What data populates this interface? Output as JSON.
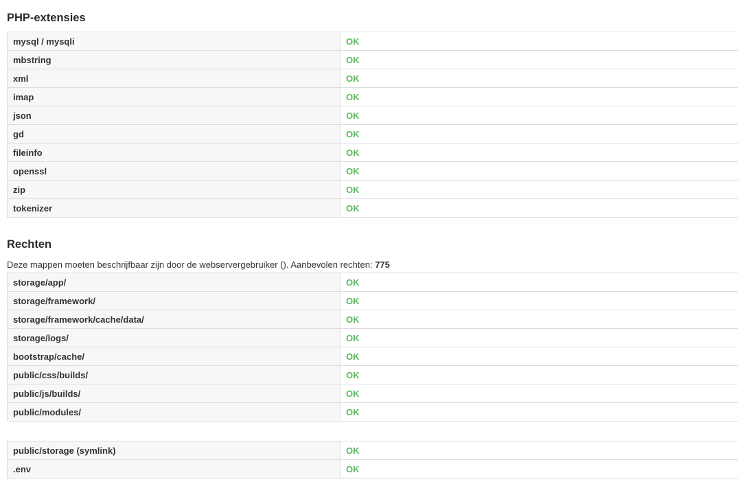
{
  "colors": {
    "ok": "#5cb85c",
    "label_bg": "#f7f7f7",
    "border": "#dddddd"
  },
  "extensions": {
    "title": "PHP-extensies",
    "rows": [
      {
        "name": "mysql / mysqli",
        "status": "OK"
      },
      {
        "name": "mbstring",
        "status": "OK"
      },
      {
        "name": "xml",
        "status": "OK"
      },
      {
        "name": "imap",
        "status": "OK"
      },
      {
        "name": "json",
        "status": "OK"
      },
      {
        "name": "gd",
        "status": "OK"
      },
      {
        "name": "fileinfo",
        "status": "OK"
      },
      {
        "name": "openssl",
        "status": "OK"
      },
      {
        "name": "zip",
        "status": "OK"
      },
      {
        "name": "tokenizer",
        "status": "OK"
      }
    ]
  },
  "permissions": {
    "title": "Rechten",
    "intro": "Deze mappen moeten beschrijfbaar zijn door de webservergebruiker (). Aanbevolen rechten: ",
    "recommended": "775",
    "rows": [
      {
        "name": "storage/app/",
        "status": "OK"
      },
      {
        "name": "storage/framework/",
        "status": "OK"
      },
      {
        "name": "storage/framework/cache/data/",
        "status": "OK"
      },
      {
        "name": "storage/logs/",
        "status": "OK"
      },
      {
        "name": "bootstrap/cache/",
        "status": "OK"
      },
      {
        "name": "public/css/builds/",
        "status": "OK"
      },
      {
        "name": "public/js/builds/",
        "status": "OK"
      },
      {
        "name": "public/modules/",
        "status": "OK"
      }
    ],
    "extra_rows": [
      {
        "name": "public/storage (symlink)",
        "status": "OK"
      },
      {
        "name": ".env",
        "status": "OK"
      }
    ]
  }
}
